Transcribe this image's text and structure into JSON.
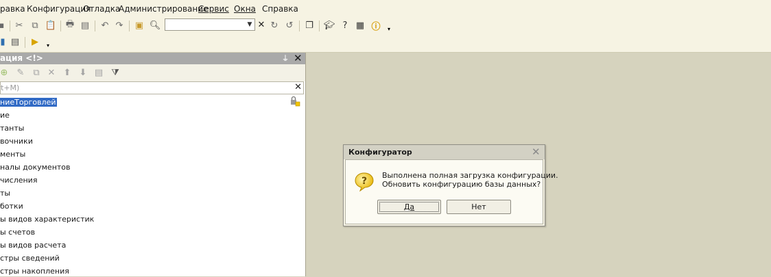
{
  "menu": {
    "items": [
      "равка",
      "Конфигурация",
      "Отладка",
      "Администрирование",
      "Сервис",
      "Окна",
      "Справка"
    ]
  },
  "toolbar": {
    "icons": [
      "copy-icon",
      "cut-icon",
      "copy-icon",
      "paste-icon",
      "print-icon",
      "print-preview-icon",
      "undo-icon",
      "redo-icon",
      "find-in-tree-icon",
      "search-icon",
      "find-next-icon",
      "find-prev-icon",
      "windows-icon",
      "syntax-helper-icon",
      "help-icon",
      "help-book-icon",
      "info-icon"
    ],
    "search_value": ""
  },
  "toolbar2": {
    "icons": [
      "database-icon",
      "table-icon",
      "run-debug-icon"
    ]
  },
  "panel": {
    "title": "ация <!>",
    "search_placeholder": "t+M)",
    "tree": [
      {
        "label": "ниеТорговлей",
        "selected": true
      },
      {
        "label": "ие"
      },
      {
        "label": "танты"
      },
      {
        "label": "вочники"
      },
      {
        "label": "менты"
      },
      {
        "label": "налы документов"
      },
      {
        "label": "числения"
      },
      {
        "label": "ты"
      },
      {
        "label": "ботки"
      },
      {
        "label": "ы видов характеристик"
      },
      {
        "label": "ы счетов"
      },
      {
        "label": "ы видов расчета"
      },
      {
        "label": "стры сведений"
      },
      {
        "label": "стры накопления"
      }
    ]
  },
  "dialog": {
    "title": "Конфигуратор",
    "message_line1": "Выполнена полная загрузка конфигурации.",
    "message_line2": "Обновить конфигурацию базы данных?",
    "yes_label": "Да",
    "no_label": "Нет"
  },
  "colors": {
    "workspace_bg": "#d6d3be",
    "toolbar_bg": "#f6f3e3",
    "panel_header": "#a9a9a9",
    "selection": "#316ac5"
  }
}
